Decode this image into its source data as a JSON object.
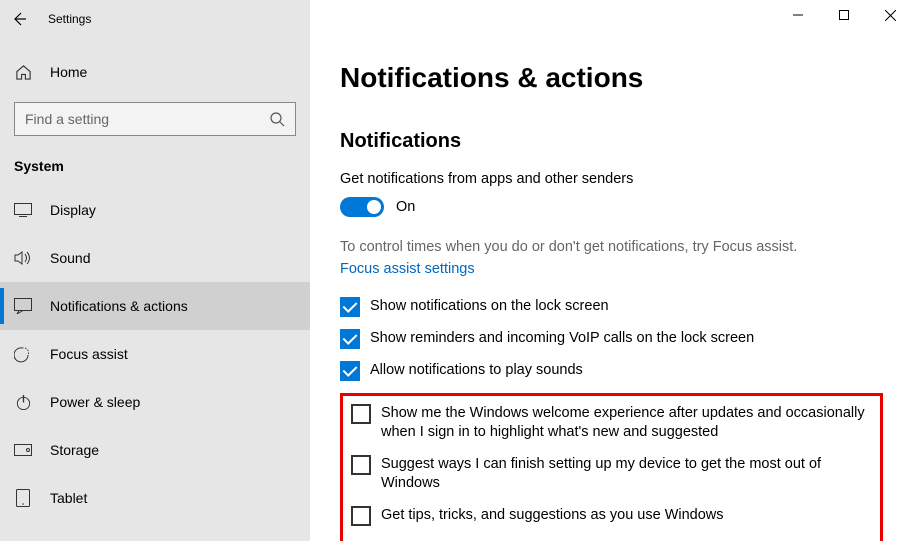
{
  "window": {
    "title": "Settings"
  },
  "sidebar": {
    "home": "Home",
    "search_placeholder": "Find a setting",
    "category": "System",
    "items": [
      {
        "label": "Display"
      },
      {
        "label": "Sound"
      },
      {
        "label": "Notifications & actions"
      },
      {
        "label": "Focus assist"
      },
      {
        "label": "Power & sleep"
      },
      {
        "label": "Storage"
      },
      {
        "label": "Tablet"
      }
    ]
  },
  "content": {
    "page_title": "Notifications & actions",
    "section_title": "Notifications",
    "toggle_label": "Get notifications from apps and other senders",
    "toggle_state": "On",
    "focus_text": "To control times when you do or don't get notifications, try Focus assist.",
    "focus_link": "Focus assist settings",
    "checks": [
      {
        "checked": true,
        "label": "Show notifications on the lock screen"
      },
      {
        "checked": true,
        "label": "Show reminders and incoming VoIP calls on the lock screen"
      },
      {
        "checked": true,
        "label": "Allow notifications to play sounds"
      },
      {
        "checked": false,
        "label": "Show me the Windows welcome experience after updates and occasionally when I sign in to highlight what's new and suggested"
      },
      {
        "checked": false,
        "label": "Suggest ways I can finish setting up my device to get the most out of Windows"
      },
      {
        "checked": false,
        "label": "Get tips, tricks, and suggestions as you use Windows"
      }
    ]
  }
}
